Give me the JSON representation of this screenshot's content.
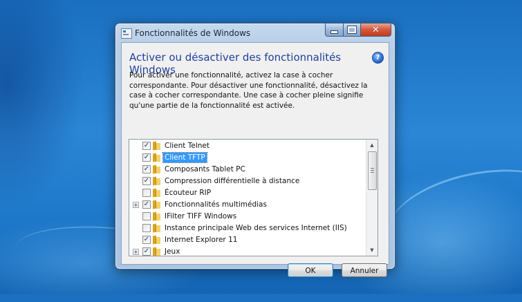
{
  "window": {
    "title": "Fonctionnalités de Windows",
    "caption_min": "",
    "caption_max": "",
    "caption_close": "✕"
  },
  "dialog": {
    "heading": "Activer ou désactiver des fonctionnalités Windows",
    "help_label": "?",
    "description": "Pour activer une fonctionnalité, activez la case à cocher correspondante. Pour désactiver une fonctionnalité, désactivez la case à cocher correspondante. Une case à cocher pleine signifie qu'une partie de la fonctionnalité est activée."
  },
  "features": [
    {
      "label": "Client Telnet",
      "checked": true,
      "expandable": false,
      "selected": false
    },
    {
      "label": "Client TFTP",
      "checked": true,
      "expandable": false,
      "selected": true
    },
    {
      "label": "Composants Tablet PC",
      "checked": true,
      "expandable": false,
      "selected": false
    },
    {
      "label": "Compression différentielle à distance",
      "checked": true,
      "expandable": false,
      "selected": false
    },
    {
      "label": "Écouteur RIP",
      "checked": false,
      "expandable": false,
      "selected": false
    },
    {
      "label": "Fonctionnalités multimédias",
      "checked": true,
      "expandable": true,
      "selected": false
    },
    {
      "label": "IFilter TIFF Windows",
      "checked": false,
      "expandable": false,
      "selected": false
    },
    {
      "label": "Instance principale Web des services Internet (IIS)",
      "checked": false,
      "expandable": false,
      "selected": false
    },
    {
      "label": "Internet Explorer 11",
      "checked": true,
      "expandable": false,
      "selected": false
    },
    {
      "label": "Jeux",
      "checked": true,
      "expandable": true,
      "selected": false
    }
  ],
  "buttons": {
    "ok": "OK",
    "cancel": "Annuler"
  },
  "glyphs": {
    "check": "✓",
    "expand": "+",
    "scroll_up": "▲",
    "scroll_down": "▼"
  },
  "colors": {
    "heading": "#1f3f99",
    "selection": "#3399ff",
    "desktop": "#2b86d6"
  }
}
